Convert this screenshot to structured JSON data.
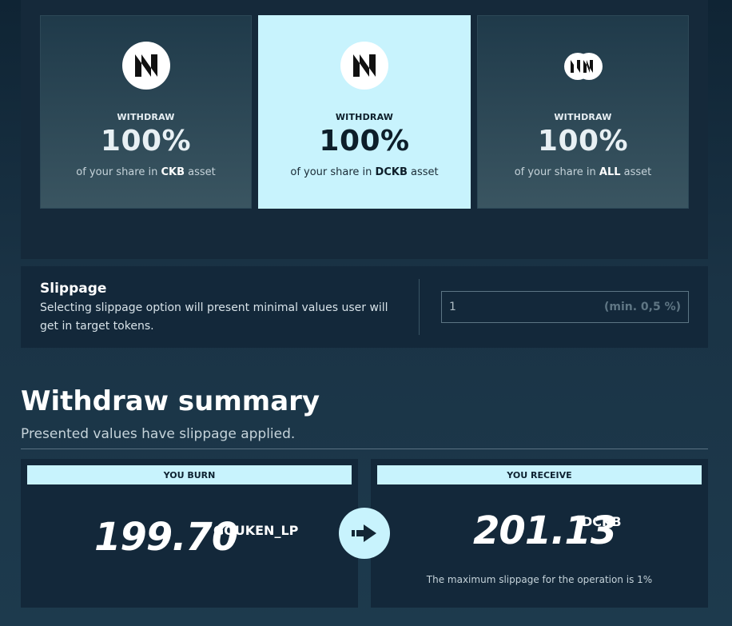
{
  "options": [
    {
      "label": "WITHDRAW",
      "percent": "100%",
      "desc_prefix": "of your share in",
      "asset": "CKB",
      "desc_suffix": "asset"
    },
    {
      "label": "WITHDRAW",
      "percent": "100%",
      "desc_prefix": "of your share in",
      "asset": "DCKB",
      "desc_suffix": "asset"
    },
    {
      "label": "WITHDRAW",
      "percent": "100%",
      "desc_prefix": "of your share in",
      "asset": "ALL",
      "desc_suffix": "asset"
    }
  ],
  "slippage": {
    "title": "Slippage",
    "description": "Selecting slippage option will present minimal values user will get in target tokens.",
    "value": "1",
    "hint": "(min. 0,5 %)"
  },
  "summary": {
    "title": "Withdraw summary",
    "subtitle": "Presented values have slippage applied.",
    "burn": {
      "header": "YOU BURN",
      "amount": "199.70",
      "unit": "GOUKEN_LP"
    },
    "receive": {
      "header": "YOU RECEIVE",
      "amount": "201.13",
      "unit": "DCKB",
      "note": "The maximum slippage for the operation is 1%"
    }
  },
  "colors": {
    "accent": "#c8f3fd",
    "panel": "#13283a"
  }
}
